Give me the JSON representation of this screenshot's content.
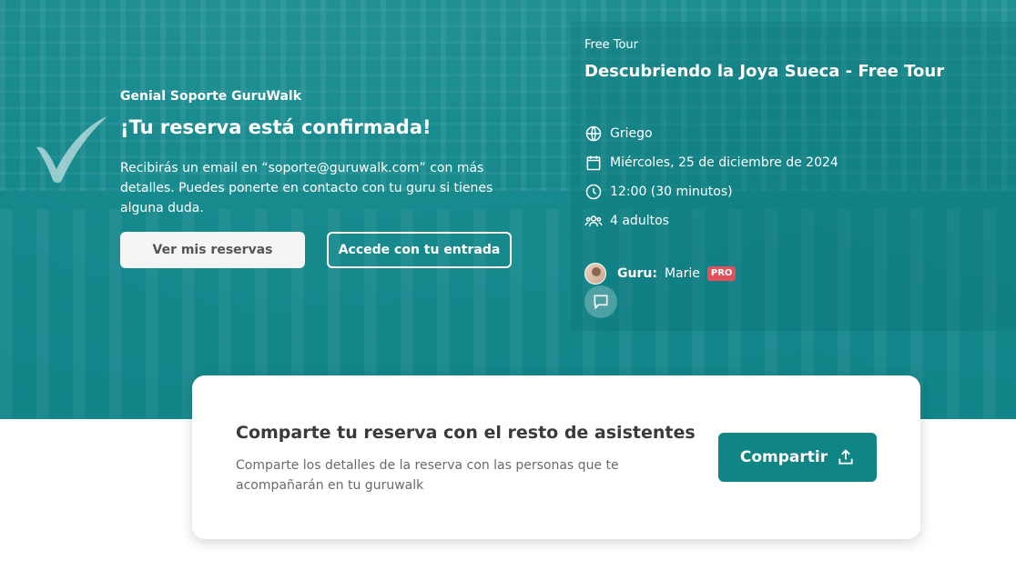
{
  "confirmation": {
    "eyebrow": "Genial Soporte GuruWalk",
    "title": "¡Tu reserva está confirmada!",
    "description": "Recibirás un email en “soporte@guruwalk.com” con más detalles. Puedes ponerte en contacto con tu guru si tienes alguna duda.",
    "buttons": {
      "view_bookings": "Ver mis reservas",
      "access_ticket": "Accede con tu entrada"
    }
  },
  "tour": {
    "type": "Free Tour",
    "title": "Descubriendo la Joya Sueca - Free Tour",
    "details": {
      "language": "Griego",
      "date": "Miércoles, 25 de diciembre de 2024",
      "time": "12:00  (30 minutos)",
      "attendees": "4 adultos"
    },
    "guru": {
      "label": "Guru:",
      "name": "Marie",
      "badge": "PRO"
    }
  },
  "share": {
    "title": "Comparte tu reserva con el resto de asistentes",
    "description": "Comparte los detalles de la reserva con las personas que te acompañarán en tu guruwalk",
    "button": "Compartir"
  },
  "colors": {
    "hero_teal": "#128a8c",
    "primary_button": "#0f8585",
    "pro_badge": "#e4505a"
  },
  "icons": [
    "check-icon",
    "globe-icon",
    "calendar-icon",
    "clock-icon",
    "users-icon",
    "chat-icon",
    "share-icon"
  ]
}
